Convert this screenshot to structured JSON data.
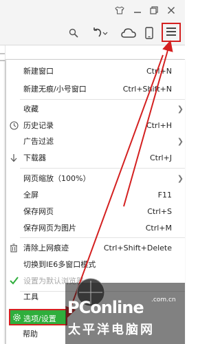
{
  "toolbar": {
    "icons": [
      "skin-icon",
      "minimize-icon",
      "restore-icon",
      "close-icon",
      "search-icon",
      "undo-icon",
      "cloud-icon",
      "mobile-icon",
      "menu-icon"
    ]
  },
  "menu": {
    "items": [
      {
        "label": "新建窗口",
        "shortcut": "Ctrl+N"
      },
      {
        "label": "新建无痕/小号窗口",
        "shortcut": "Ctrl+Shift+N"
      },
      {
        "label": "收藏",
        "shortcut": ""
      },
      {
        "label": "历史记录",
        "shortcut": "Ctrl+H"
      },
      {
        "label": "广告过滤",
        "shortcut": ""
      },
      {
        "label": "下载器",
        "shortcut": "Ctrl+J"
      },
      {
        "label": "网页缩放（100%）",
        "shortcut": ""
      },
      {
        "label": "全屏",
        "shortcut": "F11"
      },
      {
        "label": "保存网页",
        "shortcut": "Ctrl+S"
      },
      {
        "label": "保存网页为图片",
        "shortcut": "Ctrl+M"
      },
      {
        "label": "清除上网痕迹",
        "shortcut": "Ctrl+Shift+Delete"
      },
      {
        "label": "切换到IE6多窗口模式",
        "shortcut": ""
      },
      {
        "label": "设置为默认浏览器",
        "shortcut": ""
      },
      {
        "label": "工具",
        "shortcut": ""
      },
      {
        "label": "选项/设置",
        "shortcut": ""
      },
      {
        "label": "帮助",
        "shortcut": ""
      }
    ]
  },
  "watermark": {
    "logo_text": "PConline",
    "domain": ".com.cn",
    "chinese": "太平洋电脑网"
  },
  "colors": {
    "highlight_green": "#2fae3c",
    "annotation_red": "#d42020"
  }
}
